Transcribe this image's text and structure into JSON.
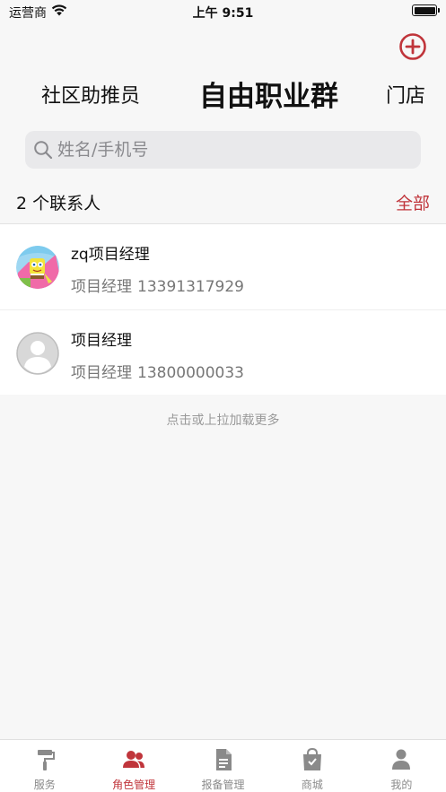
{
  "status_bar": {
    "carrier": "运营商",
    "time": "上午 9:51"
  },
  "header": {
    "tabs": [
      {
        "label": "社区助推员"
      },
      {
        "label": "自由职业群"
      },
      {
        "label": "门店"
      }
    ],
    "active_tab": "自由职业群"
  },
  "search": {
    "placeholder": "姓名/手机号",
    "value": ""
  },
  "contacts": {
    "count_label": "2 个联系人",
    "filter_label": "全部",
    "items": [
      {
        "name": "zq项目经理",
        "role": "项目经理",
        "phone": "13391317929",
        "avatar": "cartoon-avatar"
      },
      {
        "name": "项目经理",
        "role": "项目经理",
        "phone": "13800000033",
        "avatar": "default-avatar"
      }
    ],
    "load_more": "点击或上拉加载更多"
  },
  "tabbar": {
    "items": [
      {
        "label": "服务",
        "icon": "paint-roller-icon"
      },
      {
        "label": "角色管理",
        "icon": "users-icon"
      },
      {
        "label": "报备管理",
        "icon": "document-icon"
      },
      {
        "label": "商城",
        "icon": "shopping-bag-icon"
      },
      {
        "label": "我的",
        "icon": "user-icon"
      }
    ],
    "active": "角色管理"
  },
  "colors": {
    "accent": "#c0353b",
    "inactive": "#8a8a8a",
    "background": "#f7f7f7"
  }
}
